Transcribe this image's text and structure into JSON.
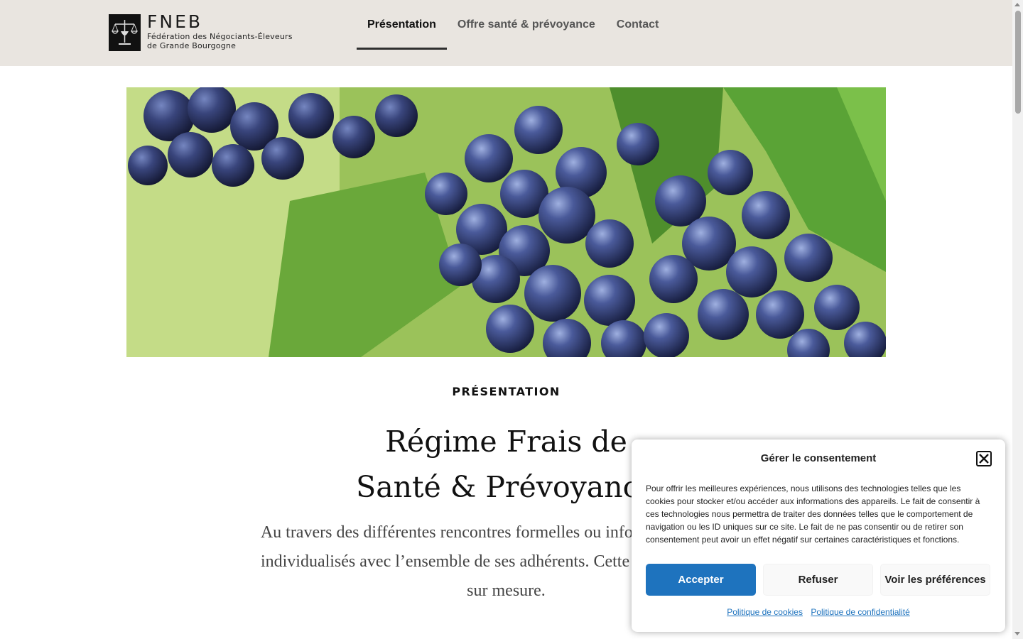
{
  "brand": {
    "abbr": "FNEB",
    "full_line1": "Fédération des Négociants-Éleveurs",
    "full_line2": "de Grande Bourgogne"
  },
  "nav": {
    "items": [
      {
        "label": "Présentation",
        "active": true
      },
      {
        "label": "Offre santé & prévoyance",
        "active": false
      },
      {
        "label": "Contact",
        "active": false
      }
    ]
  },
  "main": {
    "eyebrow": "PRÉSENTATION",
    "title_line1": "Régime Frais de",
    "title_line2": "Santé & Prévoyance",
    "lead_line1": "Au travers des différentes rencontres formelles ou informelles, la FNEB",
    "lead_line2": "individualisés avec l’ensemble de ses adhérents. Cette proximité permet",
    "lead_line3": "sur mesure."
  },
  "consent": {
    "title": "Gérer le consentement",
    "text": "Pour offrir les meilleures expériences, nous utilisons des technologies telles que les cookies pour stocker et/ou accéder aux informations des appareils. Le fait de consentir à ces technologies nous permettra de traiter des données telles que le comportement de navigation ou les ID uniques sur ce site. Le fait de ne pas consentir ou de retirer son consentement peut avoir un effet négatif sur certaines caractéristiques et fonctions.",
    "accept": "Accepter",
    "deny": "Refuser",
    "prefs": "Voir les préférences",
    "cookie_policy": "Politique de cookies",
    "privacy_policy": "Politique de confidentialité"
  },
  "colors": {
    "header_bg": "#e9e5e0",
    "accent": "#1e73be"
  }
}
